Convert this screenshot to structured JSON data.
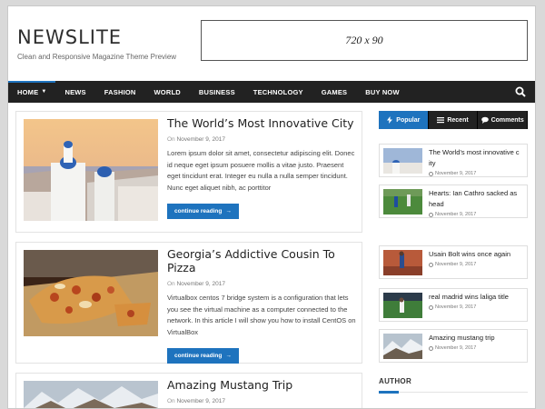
{
  "site": {
    "logo": "NEWSLITE",
    "tagline": "Clean and Responsive Magazine Theme Preview",
    "ad_text": "720 x 90"
  },
  "nav": {
    "items": [
      {
        "label": "HOME",
        "active": true
      },
      {
        "label": "NEWS"
      },
      {
        "label": "FASHION"
      },
      {
        "label": "WORLD"
      },
      {
        "label": "BUSINESS"
      },
      {
        "label": "TECHNOLOGY"
      },
      {
        "label": "GAMES"
      },
      {
        "label": "BUY NOW"
      }
    ],
    "search_icon": "search-icon",
    "home_caret": "chevron-down-icon"
  },
  "posts": [
    {
      "title": "The World’s Most Innovative City",
      "date_prefix": "On",
      "date": "November 9, 2017",
      "excerpt": "Lorem ipsum dolor sit amet, consectetur adipiscing elit. Donec id neque eget ipsum posuere mollis a vitae justo. Praesent eget tincidunt erat. Integer eu nulla a nulla semper tincidunt. Nunc eget aliquet nibh, ac porttitor",
      "button": "continue reading"
    },
    {
      "title": "Georgia’s Addictive Cousin To Pizza",
      "date_prefix": "On",
      "date": "November 9, 2017",
      "excerpt": "Virtualbox centos 7 bridge system is a configuration that lets you see the virtual machine as a computer connected to the network. In this article I will show you how to install CentOS on VirtualBox",
      "button": "continue reading"
    },
    {
      "title": "Amazing Mustang Trip",
      "date_prefix": "On",
      "date": "November 9, 2017"
    }
  ],
  "sidebar": {
    "tabs": [
      {
        "label": "Popular",
        "icon": "bolt-icon",
        "active": true
      },
      {
        "label": "Recent",
        "icon": "list-icon"
      },
      {
        "label": "Comments",
        "icon": "comment-icon"
      }
    ],
    "items": [
      {
        "title": "The World's most innovative c ity",
        "date": "November 9, 2017"
      },
      {
        "title": "Hearts: Ian Cathro sacked as head",
        "date": "November 9, 2017"
      },
      {
        "title": "Usain Bolt wins once again",
        "date": "November 9, 2017"
      },
      {
        "title": "real madrid wins laliga title",
        "date": "November 9, 2017"
      },
      {
        "title": "Amazing mustang trip",
        "date": "November 9, 2017"
      }
    ],
    "author_heading": "AUTHOR"
  },
  "colors": {
    "accent": "#1e73be",
    "nav_bg": "#222222"
  }
}
